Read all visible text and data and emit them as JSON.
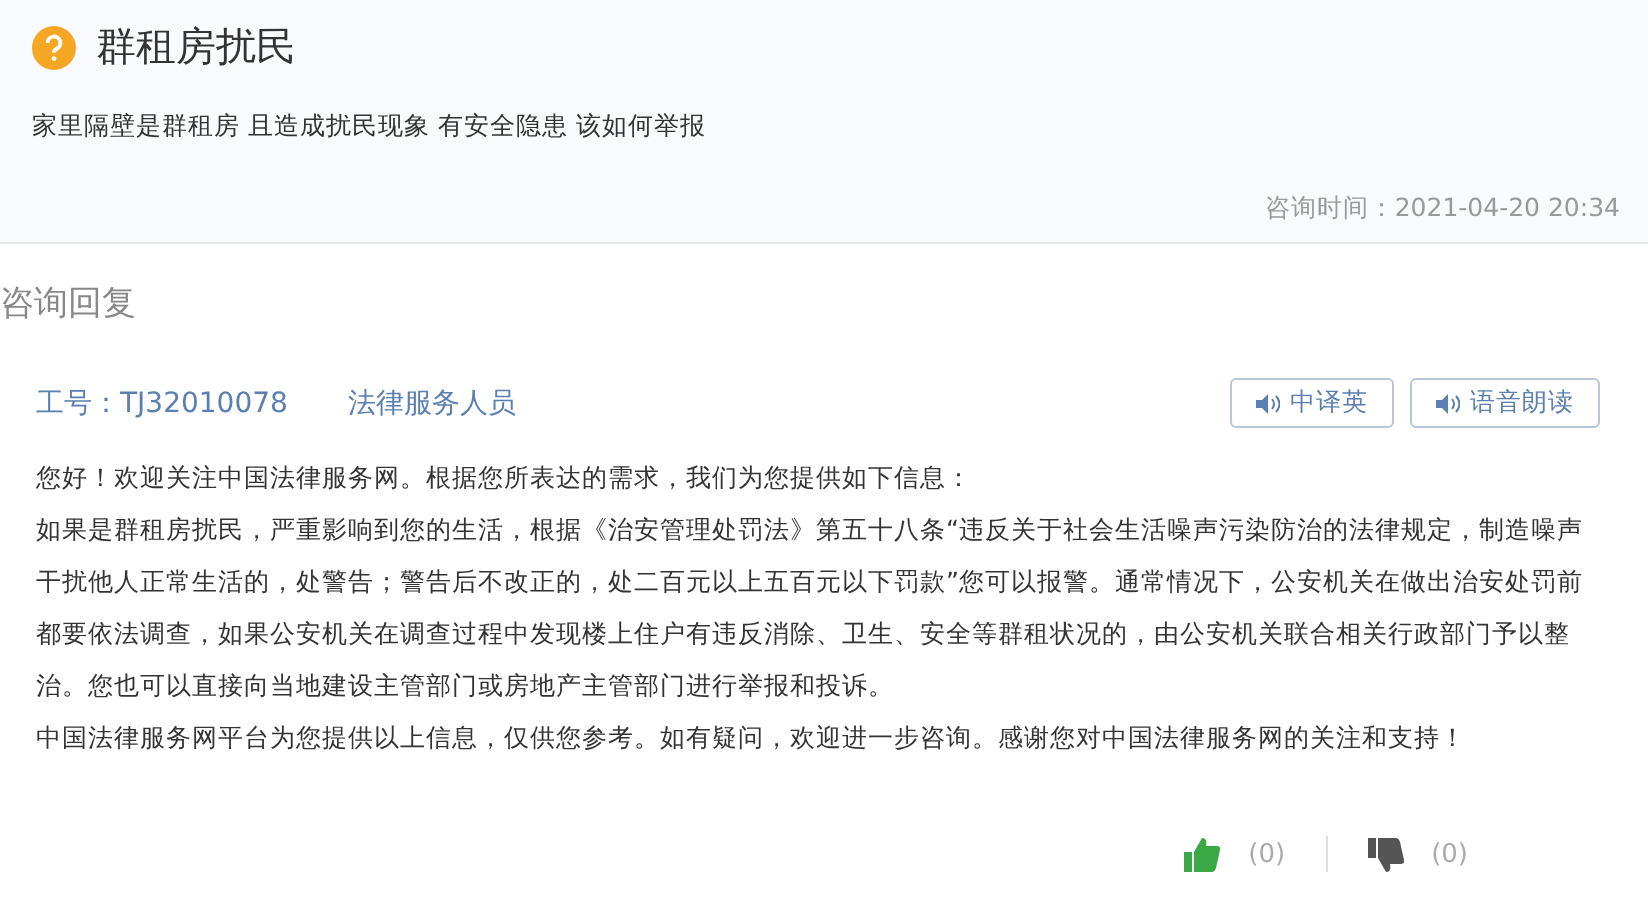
{
  "question": {
    "title": "群租房扰民",
    "text": "家里隔壁是群租房 且造成扰民现象 有安全隐患 该如何举报",
    "time_label": "咨询时间：",
    "time": "2021-04-20 20:34"
  },
  "reply": {
    "heading": "咨询回复",
    "staff_id": "工号：TJ32010078",
    "staff_role": "法律服务人员",
    "buttons": [
      {
        "label": "中译英"
      },
      {
        "label": "语音朗读"
      }
    ],
    "paragraphs": [
      "您好！欢迎关注中国法律服务网。根据您所表达的需求，我们为您提供如下信息：",
      "如果是群租房扰民，严重影响到您的生活，根据《治安管理处罚法》第五十八条“违反关于社会生活噪声污染防治的法律规定，制造噪声干扰他人正常生活的，处警告；警告后不改正的，处二百元以上五百元以下罚款”您可以报警。通常情况下，公安机关在做出治安处罚前都要依法调查，如果公安机关在调查过程中发现楼上住户有违反消除、卫生、安全等群租状况的，由公安机关联合相关行政部门予以整治。您也可以直接向当地建设主管部门或房地产主管部门进行举报和投诉。",
      "中国法律服务网平台为您提供以上信息，仅供您参考。如有疑问，欢迎进一步咨询。感谢您对中国法律服务网的关注和支持！"
    ],
    "likes": "(0)",
    "dislikes": "(0)"
  }
}
